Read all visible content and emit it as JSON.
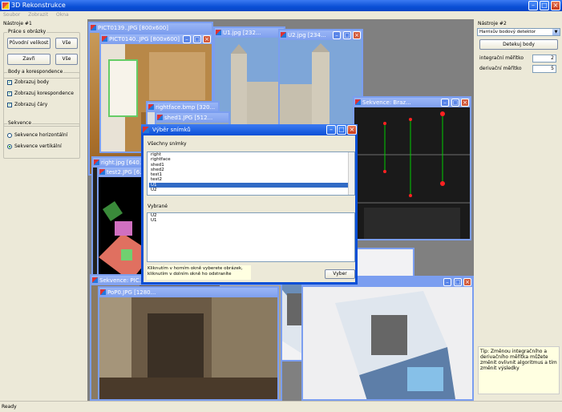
{
  "app": {
    "title": "3D Rekonstrukce"
  },
  "menu": [
    "Soubor",
    "Zobrazit",
    "Okna"
  ],
  "left_panel": {
    "title": "Nástroje #1",
    "images_group": {
      "label": "Práce s obrázky",
      "btn_original": "Původní velikost",
      "btn_all1": "Vše",
      "btn_close": "Zavři",
      "btn_all2": "Vše"
    },
    "points_group": {
      "label": "Body a korespondence",
      "show_points": "Zobrazuj body",
      "show_corr": "Zobrazuj korespondence",
      "show_lines": "Zobrazuj čáry"
    },
    "seq_group": {
      "label": "Sekvence",
      "horizontal": "Sekvence horizontální",
      "vertical": "Sekvence vertikální"
    }
  },
  "right_panel": {
    "title": "Nástroje #2",
    "detector": "Harrisův bodový detektor",
    "detect_btn": "Detekuj body",
    "int_scale_label": "integrační měřítko",
    "int_scale_value": "2",
    "der_scale_label": "derivační měřítko",
    "der_scale_value": "5",
    "tip": "Tip: Změnou integračního a derivačního měřítka můžete změnit ovlivnit algoritmus a tím změnit výsledky"
  },
  "windows": {
    "w1": "PICT0139..JPG [800x600]",
    "w2": "PICT0140..JPG [800x600]",
    "w3": "U1.jpg [232...",
    "w4": "U2.jpg [234...",
    "w5": "rightface.bmp [320...",
    "w6": "shed1.JPG [512...",
    "w7": "right.jpg [640...",
    "w8": "test2.JPG [6...",
    "w9": "Sekvence: Braz...",
    "w10": "Sekvence: PIC...",
    "w11": "PoP0.JPG [1280..."
  },
  "dialog": {
    "title": "Výběr snímků",
    "all_label": "Všechny snímky",
    "all_items": [
      "right",
      "rightface",
      "shed1",
      "shed2",
      "test1",
      "test2",
      "U1",
      "U2"
    ],
    "selected_index": 6,
    "chosen_label": "Vybrané",
    "chosen_items": [
      "U2",
      "U1"
    ],
    "hint_line1": "Kliknutím v horním okně vyberete obrázek,",
    "hint_line2": "kliknutím v dolním okně ho odstraníte",
    "select_btn": "Vyber"
  },
  "status": "Ready"
}
